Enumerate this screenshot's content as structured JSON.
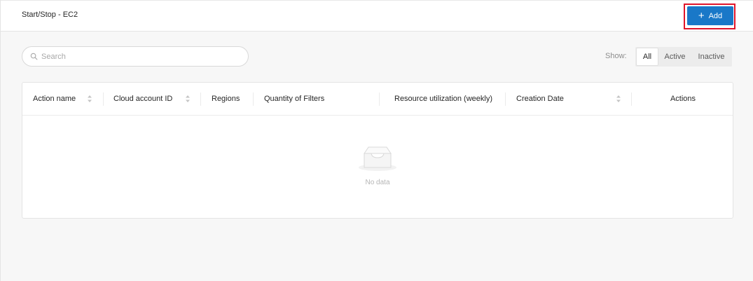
{
  "header": {
    "title": "Start/Stop - EC2",
    "add_label": "Add"
  },
  "toolbar": {
    "search_placeholder": "Search",
    "search_value": "",
    "show_label": "Show:",
    "filters": [
      "All",
      "Active",
      "Inactive"
    ],
    "selected_filter": "All"
  },
  "table": {
    "columns": [
      {
        "label": "Action name",
        "sortable": true
      },
      {
        "label": "Cloud account ID",
        "sortable": true
      },
      {
        "label": "Regions",
        "sortable": false
      },
      {
        "label": "Quantity of Filters",
        "sortable": false
      },
      {
        "label": "Resource utilization (weekly)",
        "sortable": false
      },
      {
        "label": "Creation Date",
        "sortable": true
      },
      {
        "label": "Actions",
        "sortable": false
      }
    ],
    "rows": [],
    "empty_text": "No data"
  },
  "colors": {
    "accent": "#1978c8",
    "highlight": "#e0142a",
    "background": "#f7f7f7"
  },
  "icons": [
    "plus-icon",
    "search-icon",
    "sort-icon",
    "inbox-empty-icon"
  ]
}
